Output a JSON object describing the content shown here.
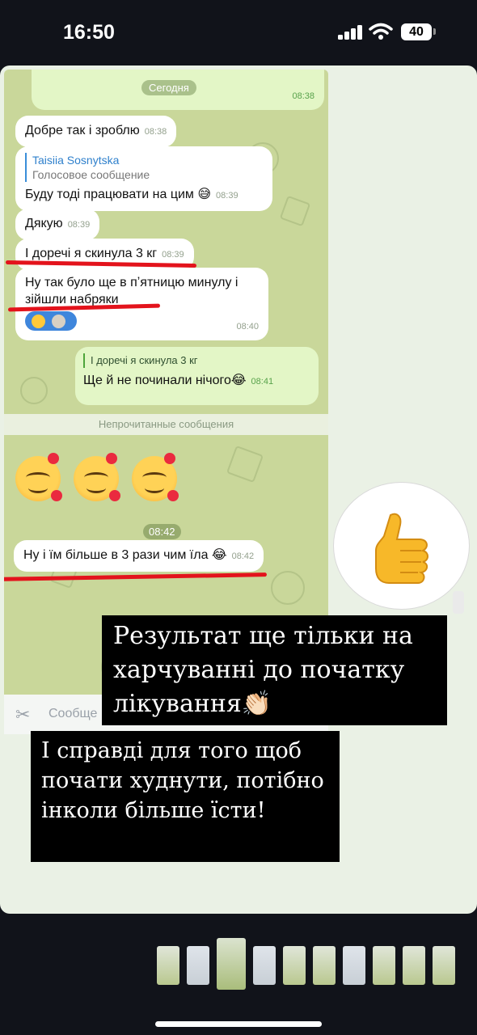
{
  "status_bar": {
    "time": "16:50",
    "battery": "40",
    "icons": [
      "signal-icon",
      "wifi-icon",
      "battery-icon"
    ]
  },
  "chat": {
    "date_label": "Сегодня",
    "first_out_time": "08:38",
    "messages": [
      {
        "text": "Добре так і зроблю",
        "time": "08:38"
      },
      {
        "reply_name": "Taisiia Sosnytska",
        "reply_text": "Голосовое сообщение",
        "text": "Буду тоді працювати на цим 😅",
        "time": "08:39"
      },
      {
        "text": "Дякую",
        "time": "08:39"
      },
      {
        "text": "І доречі я скинула 3 кг",
        "time": "08:39"
      },
      {
        "text": "Ну так було ще в пʼятницю минулу і зійшли набряки",
        "time": "08:40"
      }
    ],
    "outgoing": {
      "quote": "І доречі я скинула 3 кг",
      "text": "Ще й не починали нічого😂",
      "time": "08:41"
    },
    "unread_label": "Непрочитанные сообщения",
    "emoji_time": "08:42",
    "last_message": {
      "text": "Ну і їм більше в 3 рази чим їла 😂",
      "time": "08:42"
    },
    "input_placeholder": "Сообще"
  },
  "captions": {
    "line1": "Результат ще тільки на харчуванні до початку лікування👏🏻",
    "line2": "І справді для того щоб почати худнути, потібно інколи більше їсти!"
  },
  "colors": {
    "chat_bg": "#c9d79a",
    "outgoing_bubble": "#e3f6c6",
    "underline_red": "#e3131c",
    "reaction_blue": "#3f86dc"
  }
}
